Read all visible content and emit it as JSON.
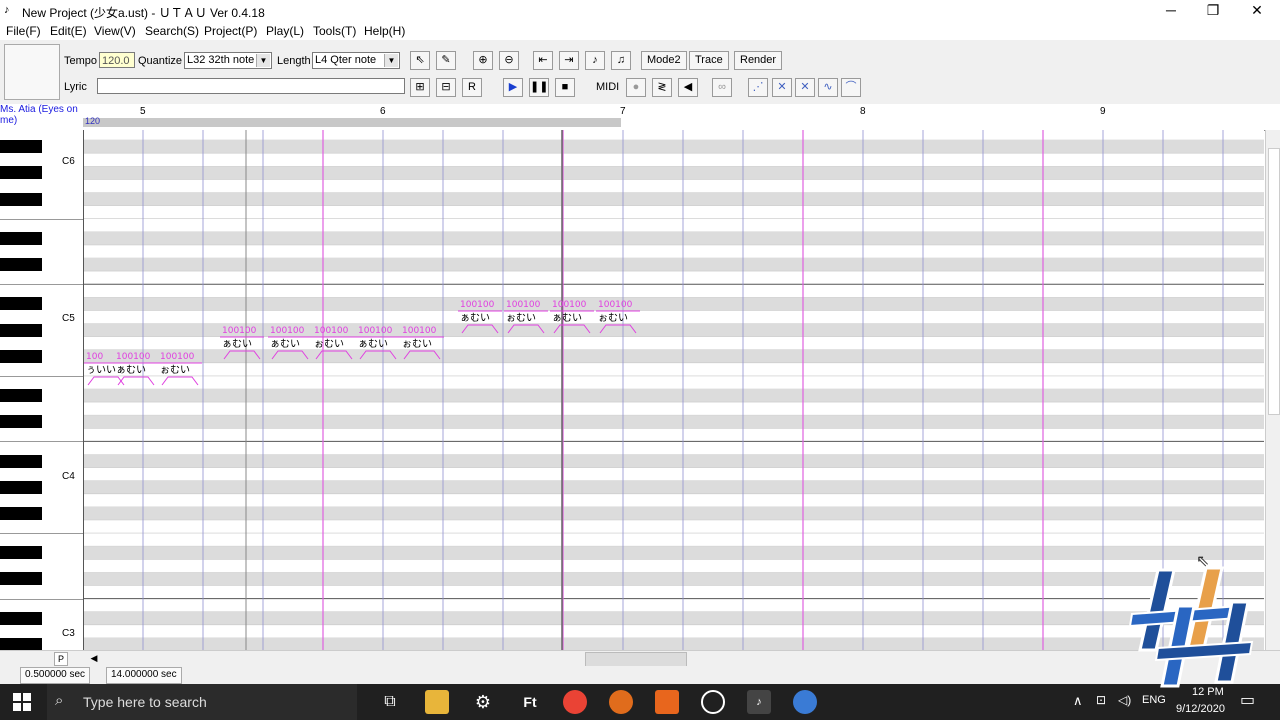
{
  "window": {
    "title": "New Project (少女a.ust) - ＵＴＡＵ Ver 0.4.18",
    "minimize": "─",
    "restore": "❐",
    "close": "✕"
  },
  "menu": [
    "File(F)",
    "Edit(E)",
    "View(V)",
    "Search(S)",
    "Project(P)",
    "Play(L)",
    "Tools(T)",
    "Help(H)"
  ],
  "toolbar": {
    "tempo_label": "Tempo",
    "tempo_value": "120.0",
    "quantize_label": "Quantize",
    "quantize_value": "L32 32th note",
    "length_label": "Length",
    "length_value": "L4  Qter note",
    "lyric_label": "Lyric",
    "lyric_value": "",
    "mode2": "Mode2",
    "trace": "Trace",
    "render": "Render",
    "midi": "MIDI"
  },
  "ruler": {
    "singer": "Ms. Atia (Eyes on me)",
    "tempo_marker": "120",
    "measures": [
      "5",
      "6",
      "7",
      "8",
      "9"
    ]
  },
  "piano": {
    "labels": [
      "C6",
      "C5",
      "C4",
      "C3"
    ]
  },
  "notes": [
    {
      "lyric": "ぅいい",
      "vel": "100"
    },
    {
      "lyric": "ぁむい",
      "vel": "100100"
    },
    {
      "lyric": "ぉむい",
      "vel": "100100"
    },
    {
      "lyric": "ぁむい",
      "vel": "100100"
    },
    {
      "lyric": "ぁむい",
      "vel": "100100"
    },
    {
      "lyric": "ぉむい",
      "vel": "100100"
    },
    {
      "lyric": "ぁむい",
      "vel": "100100"
    },
    {
      "lyric": "ぉむい",
      "vel": "100100"
    },
    {
      "lyric": "ぁむい",
      "vel": "100100"
    },
    {
      "lyric": "ぉむい",
      "vel": "100100"
    },
    {
      "lyric": "ぁむい",
      "vel": "100100"
    },
    {
      "lyric": "ぉむい",
      "vel": "100100"
    }
  ],
  "status": {
    "pos": "0.500000 sec",
    "total": "14.000000 sec",
    "p_btn": "P"
  },
  "taskbar": {
    "search_placeholder": "Type here to search",
    "lang": "ENG",
    "time": "12 PM",
    "date": "9/12/2020"
  },
  "colors": {
    "note_pink": "#e040e0",
    "measure_line": "#e060e0",
    "beat_line": "#9090d0",
    "tempo_bar": "#c8c8c8"
  }
}
